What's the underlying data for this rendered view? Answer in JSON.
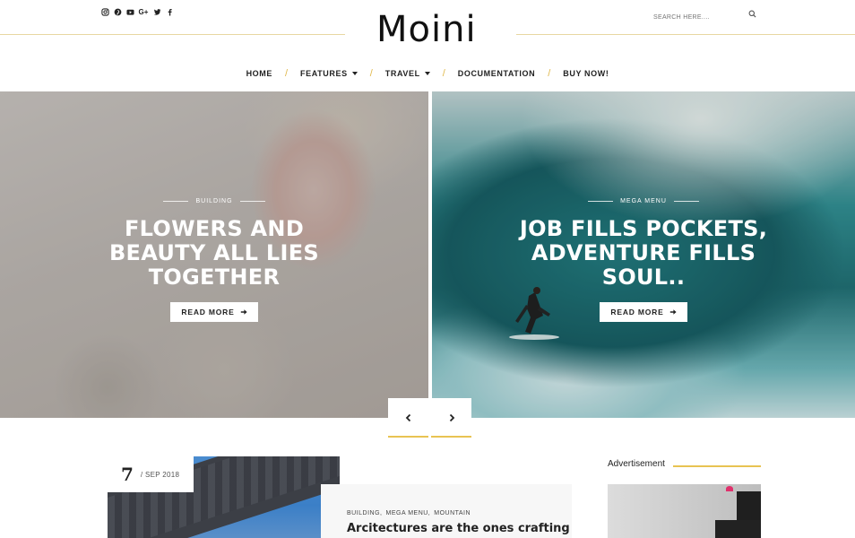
{
  "header": {
    "social_icons": [
      "instagram-icon",
      "pinterest-icon",
      "youtube-icon",
      "google-plus-icon",
      "twitter-icon",
      "facebook-icon"
    ],
    "logo_text": "Moini",
    "search_placeholder": "SEARCH HERE....",
    "accent_color": "#e8c352"
  },
  "nav": {
    "items": [
      {
        "label": "HOME",
        "has_dropdown": false
      },
      {
        "label": "FEATURES",
        "has_dropdown": true
      },
      {
        "label": "TRAVEL",
        "has_dropdown": true
      },
      {
        "label": "DOCUMENTATION",
        "has_dropdown": false
      },
      {
        "label": "BUY NOW!",
        "has_dropdown": false
      }
    ],
    "separator": "/"
  },
  "slider": {
    "slides": [
      {
        "category": "BUILDING",
        "title_lines": [
          "FLOWERS AND",
          "BEAUTY ALL LIES",
          "TOGETHER"
        ],
        "button": "READ MORE"
      },
      {
        "category": "MEGA MENU",
        "title_lines": [
          "JOB FILLS POCKETS,",
          "ADVENTURE FILLS",
          "SOUL.."
        ],
        "button": "READ MORE"
      }
    ]
  },
  "post": {
    "day": "7",
    "month_year": "/ SEP 2018",
    "tags": [
      "BUILDING,",
      "MEGA MENU,",
      "MOUNTAIN"
    ],
    "title": "Arcitectures are the ones crafting"
  },
  "sidebar": {
    "ad_label": "Advertisement"
  }
}
